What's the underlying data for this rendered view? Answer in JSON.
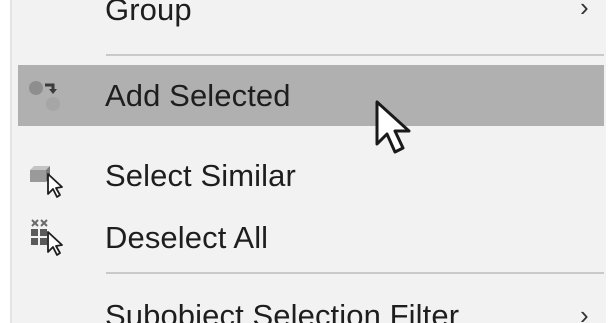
{
  "menu": {
    "items": [
      {
        "label": "Group",
        "has_submenu": true,
        "icon": "none"
      },
      {
        "label": "Add Selected",
        "highlighted": true,
        "icon": "add-selected-icon"
      },
      {
        "label": "Select Similar",
        "icon": "select-similar-icon"
      },
      {
        "label": "Deselect All",
        "icon": "deselect-all-icon"
      },
      {
        "label": "Subobject Selection Filter",
        "has_submenu": true,
        "icon": "none"
      }
    ],
    "submenu_arrow": "›",
    "highlight_color": "#b0b0b0",
    "background_color": "#f2f2f2"
  }
}
